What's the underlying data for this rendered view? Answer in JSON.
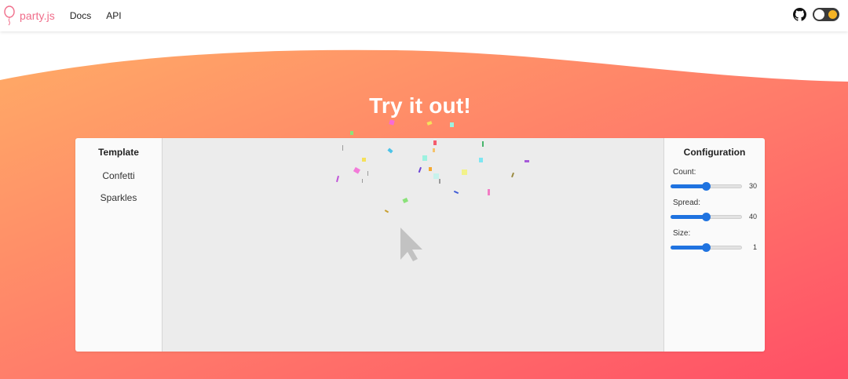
{
  "navbar": {
    "brand": "party.js",
    "links": [
      "Docs",
      "API"
    ],
    "icons": [
      "balloon-icon",
      "github-icon"
    ],
    "theme_toggle": {
      "state": "light",
      "icon": "sun-icon"
    }
  },
  "hero": {
    "title": "Try it out!",
    "gradient": [
      "#ffa866",
      "#ff7a6a",
      "#ff5066"
    ]
  },
  "demo": {
    "templates_header": "Template",
    "templates": [
      "Confetti",
      "Sparkles"
    ],
    "config_header": "Configuration",
    "config": [
      {
        "label": "Count:",
        "value": "30",
        "fraction": 0.5
      },
      {
        "label": "Spread:",
        "value": "40",
        "fraction": 0.5
      },
      {
        "label": "Size:",
        "value": "1",
        "fraction": 0.5
      }
    ],
    "accent": "#1f73e0",
    "cursor_icon": "arrow-cursor-icon"
  }
}
